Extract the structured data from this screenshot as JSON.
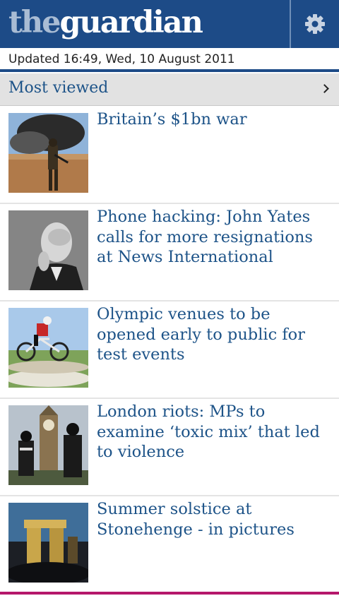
{
  "header": {
    "logo_the": "the",
    "logo_guardian": "guardian",
    "settings_icon": "gear-icon",
    "background": "#1d4b87"
  },
  "status": {
    "updated": "Updated 16:49, Wed, 10 August 2011"
  },
  "section": {
    "title": "Most viewed",
    "chevron_icon": "chevron-right-icon"
  },
  "articles": [
    {
      "headline": "Britain’s $1bn war",
      "image": "soldier-desert-photo"
    },
    {
      "headline": "Phone hacking: John Yates calls for more resignations at News International",
      "image": "john-yates-portrait-photo"
    },
    {
      "headline": "Olympic venues to be opened early to public for test events",
      "image": "mountain-biker-photo"
    },
    {
      "headline": "London riots: MPs to examine ‘toxic mix’ that led to violence",
      "image": "police-big-ben-photo"
    },
    {
      "headline": "Summer solstice at Stonehenge - in pictures",
      "image": "stonehenge-photo"
    }
  ],
  "colors": {
    "brand_blue": "#1d4b87",
    "headline_blue": "#1d5388",
    "section_bg": "#e2e2e2",
    "accent_pink": "#b5176b"
  }
}
